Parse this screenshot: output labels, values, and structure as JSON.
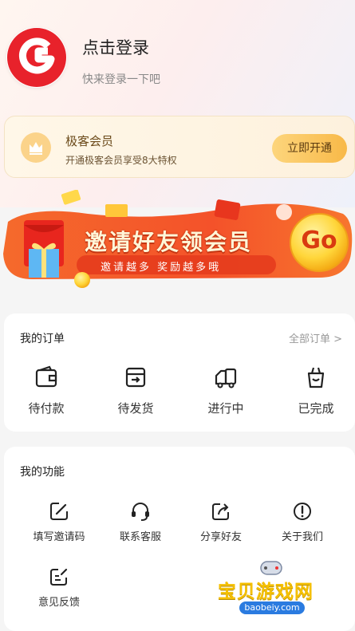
{
  "profile": {
    "login_title": "点击登录",
    "login_subtitle": "快来登录一下吧"
  },
  "vip": {
    "title": "极客会员",
    "subtitle": "开通极客会员享受8大特权",
    "button": "立即开通"
  },
  "banner": {
    "title": "邀请好友领会员",
    "subtitle": "邀请越多  奖励越多哦",
    "go": "Go"
  },
  "orders": {
    "title": "我的订单",
    "all_link": "全部订单 >",
    "items": [
      {
        "label": "待付款",
        "icon": "wallet-icon"
      },
      {
        "label": "待发货",
        "icon": "shipping-box-icon"
      },
      {
        "label": "进行中",
        "icon": "truck-icon"
      },
      {
        "label": "已完成",
        "icon": "bag-icon"
      }
    ]
  },
  "functions": {
    "title": "我的功能",
    "items": [
      {
        "label": "填写邀请码",
        "icon": "edit-icon"
      },
      {
        "label": "联系客服",
        "icon": "headset-icon"
      },
      {
        "label": "分享好友",
        "icon": "share-icon"
      },
      {
        "label": "关于我们",
        "icon": "info-icon"
      },
      {
        "label": "意见反馈",
        "icon": "feedback-icon"
      }
    ]
  },
  "watermark": {
    "text": "宝贝游戏网",
    "url": "baobeiy.com"
  },
  "colors": {
    "brand_red": "#e8222b",
    "vip_gold": "#f8b948",
    "banner_orange": "#f0642a"
  }
}
